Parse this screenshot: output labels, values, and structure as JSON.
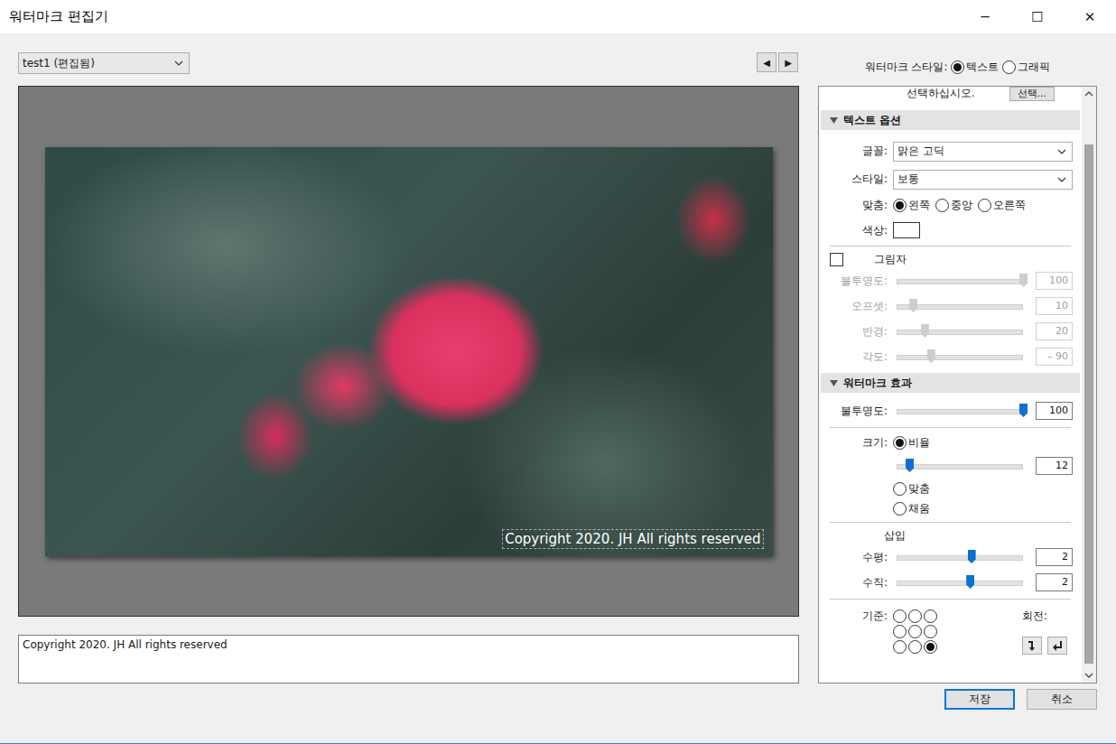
{
  "window": {
    "title": "워터마크 편집기",
    "controls": [
      "─",
      "☐",
      "✕"
    ]
  },
  "preset": {
    "value": "test1 (편집됨)"
  },
  "nav": [
    "◀",
    "▶"
  ],
  "watermark_style": {
    "label": "워터마크 스타일:",
    "options": [
      {
        "label": "텍스트",
        "selected": true
      },
      {
        "label": "그래픽",
        "selected": false
      }
    ]
  },
  "preview": {
    "watermark_text": "Copyright 2020. JH All rights reserved"
  },
  "text_box": {
    "value": "Copyright 2020. JH All rights reserved"
  },
  "panel": {
    "top_hint": "선택하십시오.",
    "top_button": "선택...",
    "text_options": {
      "title": "텍스트 옵션",
      "expanded": true,
      "fields": [
        {
          "label": "글꼴:",
          "value": "맑은 고딕"
        },
        {
          "label": "스타일:",
          "value": "보통"
        }
      ],
      "align": {
        "label": "맞춤:",
        "options": [
          {
            "label": "왼쪽",
            "selected": true
          },
          {
            "label": "중앙",
            "selected": false
          },
          {
            "label": "오른쪽",
            "selected": false
          }
        ]
      },
      "color": {
        "label": "색상:",
        "value": "#ffffff"
      },
      "shadow": {
        "label": "그림자",
        "checked": false,
        "sliders": [
          {
            "label": "불투명도:",
            "value": "100",
            "level": 1,
            "disabled": true
          },
          {
            "label": "오프셋:",
            "value": "10",
            "level": 0.13,
            "disabled": true
          },
          {
            "label": "반경:",
            "value": "20",
            "level": 0.22,
            "disabled": true
          },
          {
            "label": "각도:",
            "value": "– 90",
            "level": 0.27,
            "disabled": true
          }
        ]
      }
    },
    "effects": {
      "title": "워터마크 효과",
      "expanded": true,
      "opacity": {
        "label": "불투명도:",
        "value": "100",
        "level": 1,
        "disabled": false
      },
      "size": {
        "label": "크기:",
        "options": [
          {
            "label": "비율",
            "selected": true
          },
          {
            "label": "맞춤",
            "selected": false
          },
          {
            "label": "채움",
            "selected": false
          }
        ],
        "slider": {
          "value": "12",
          "level": 0.1,
          "disabled": false
        }
      },
      "inset": {
        "title": "삽입",
        "sliders": [
          {
            "label": "수평:",
            "value": "2",
            "level": 0.59,
            "disabled": false
          },
          {
            "label": "수직:",
            "value": "2",
            "level": 0.58,
            "disabled": false
          }
        ]
      },
      "anchor": {
        "label": "기준:",
        "cells": [
          {
            "selected": false
          },
          {
            "selected": false
          },
          {
            "selected": false
          },
          {
            "selected": false
          },
          {
            "selected": false
          },
          {
            "selected": false
          },
          {
            "selected": false
          },
          {
            "selected": false
          },
          {
            "selected": true
          }
        ]
      },
      "rotate": {
        "label": "회전:"
      }
    }
  },
  "buttons": [
    {
      "label": "저장",
      "default": true
    },
    {
      "label": "취소",
      "default": false
    }
  ]
}
